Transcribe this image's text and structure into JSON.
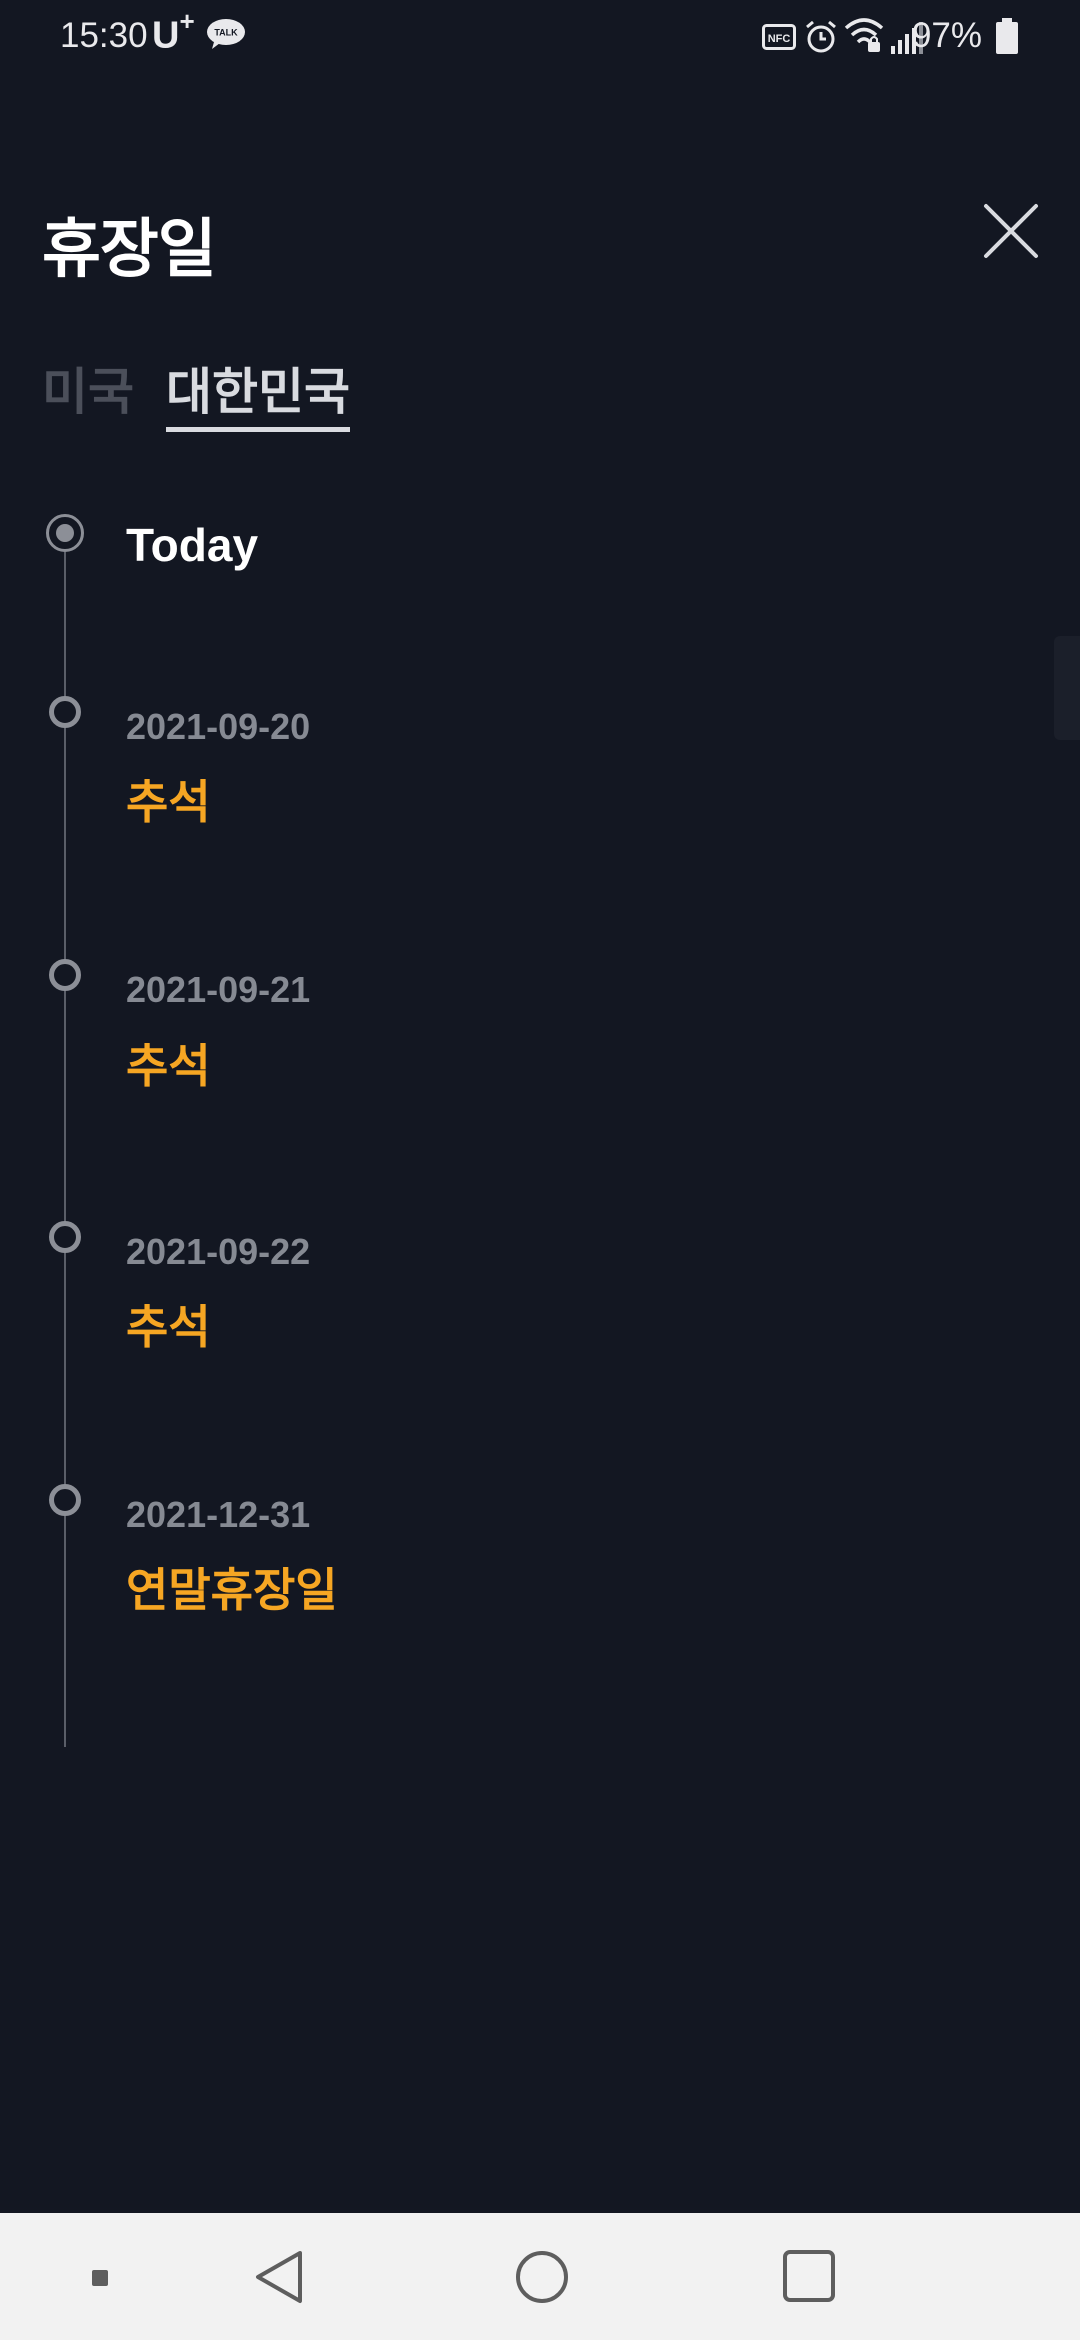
{
  "status_bar": {
    "time": "15:30",
    "carrier": "U",
    "carrier_plus": "+",
    "talk_badge": "TALK",
    "nfc_label": "NFC",
    "battery": "97%",
    "icons": [
      "talk-icon",
      "nfc-icon",
      "alarm-icon",
      "wifi-icon",
      "signal-icon",
      "battery-icon"
    ]
  },
  "header": {
    "title": "휴장일",
    "close_icon": "close-icon"
  },
  "tabs": [
    {
      "label": "미국",
      "selected": false
    },
    {
      "label": "대한민국",
      "selected": true
    }
  ],
  "timeline": {
    "today_label": "Today",
    "holidays": [
      {
        "date": "2021-09-20",
        "name": "추석"
      },
      {
        "date": "2021-09-21",
        "name": "추석"
      },
      {
        "date": "2021-09-22",
        "name": "추석"
      },
      {
        "date": "2021-12-31",
        "name": "연말휴장일"
      }
    ]
  },
  "colors": {
    "background": "#131722",
    "accent_holiday": "#f6a623",
    "date_gray": "#868a93",
    "tab_inactive": "#4b4f5a",
    "tab_active": "#d9dbe0",
    "nav_bar": "#f2f2f2"
  },
  "nav_bar": {
    "icons": [
      "nav-dot-icon",
      "back-icon",
      "home-icon",
      "recents-icon"
    ]
  }
}
